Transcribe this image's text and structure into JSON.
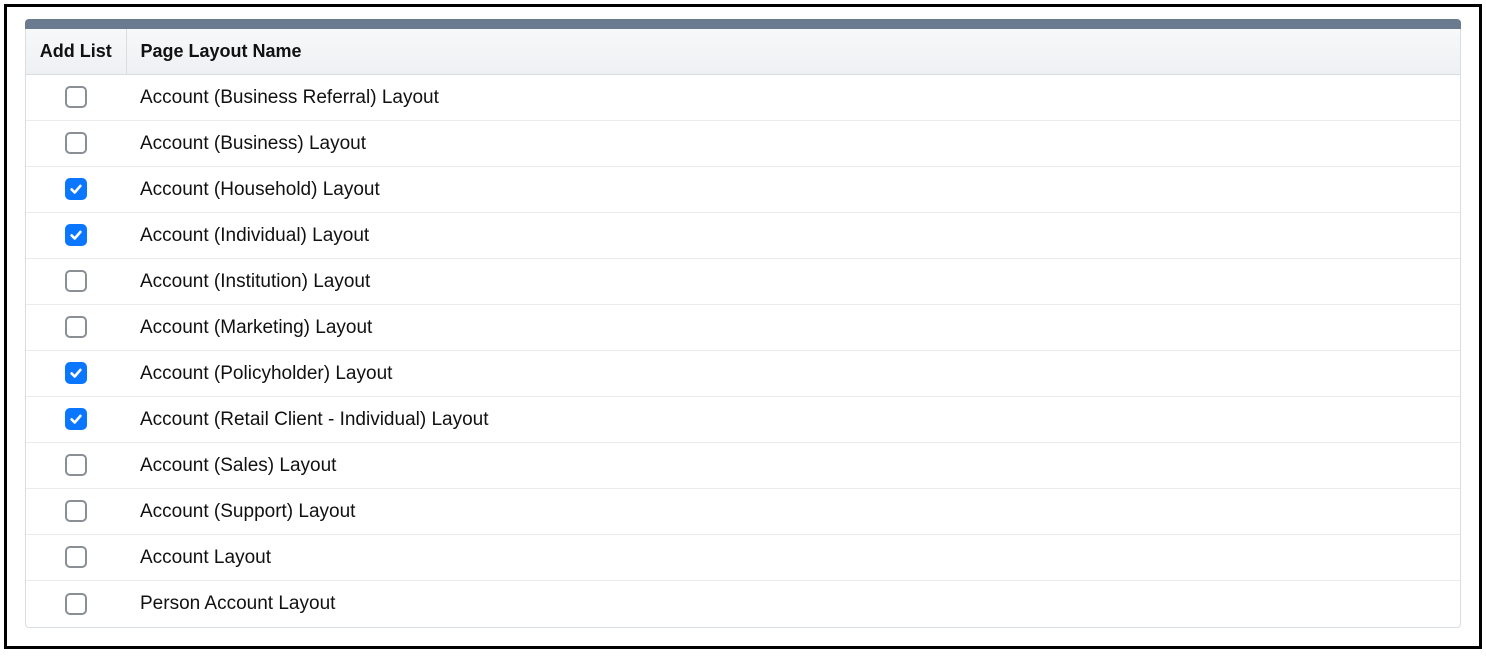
{
  "table": {
    "headers": {
      "add_list": "Add List",
      "page_layout_name": "Page Layout Name"
    },
    "rows": [
      {
        "checked": false,
        "name": "Account (Business Referral) Layout"
      },
      {
        "checked": false,
        "name": "Account (Business) Layout"
      },
      {
        "checked": true,
        "name": "Account (Household) Layout"
      },
      {
        "checked": true,
        "name": "Account (Individual) Layout"
      },
      {
        "checked": false,
        "name": "Account (Institution) Layout"
      },
      {
        "checked": false,
        "name": "Account (Marketing) Layout"
      },
      {
        "checked": true,
        "name": "Account (Policyholder) Layout"
      },
      {
        "checked": true,
        "name": "Account (Retail Client - Individual) Layout"
      },
      {
        "checked": false,
        "name": "Account (Sales) Layout"
      },
      {
        "checked": false,
        "name": "Account (Support) Layout"
      },
      {
        "checked": false,
        "name": "Account Layout"
      },
      {
        "checked": false,
        "name": "Person Account Layout"
      }
    ]
  }
}
